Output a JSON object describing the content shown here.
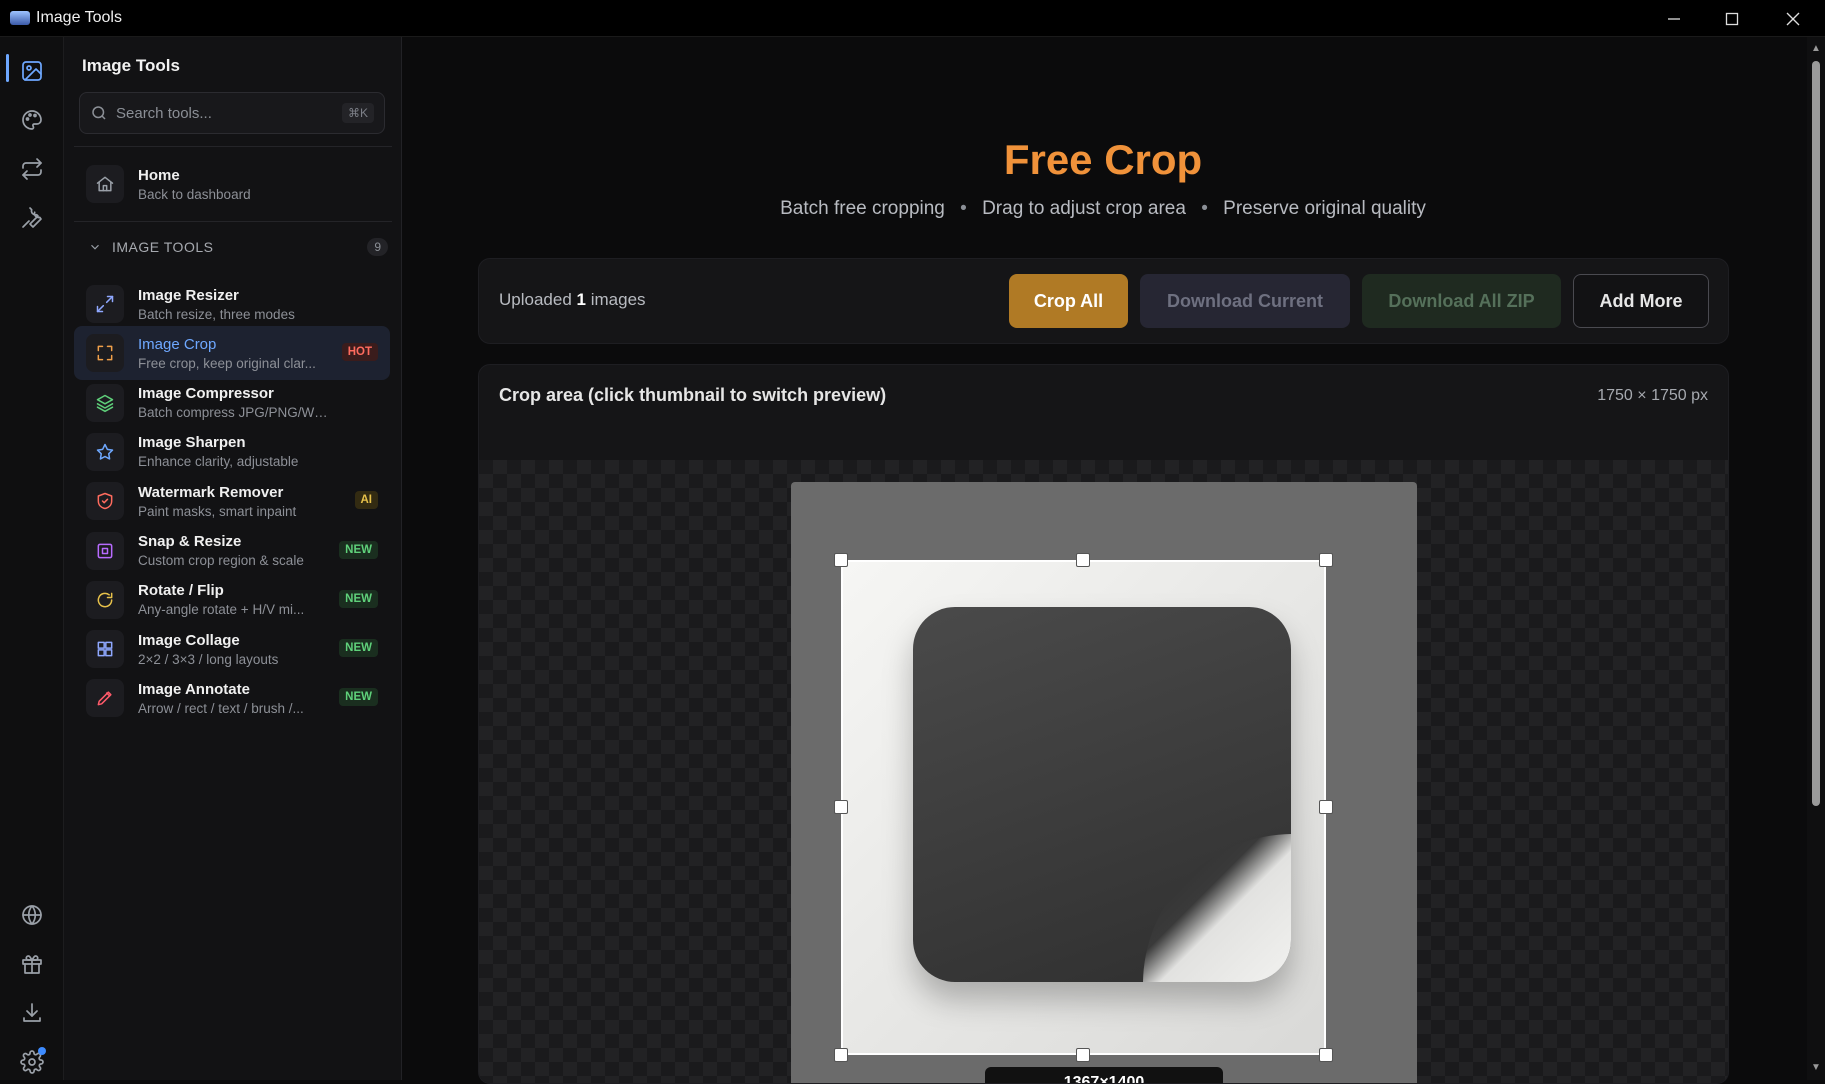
{
  "window": {
    "title": "Image Tools"
  },
  "sidebar": {
    "title": "Image Tools",
    "search": {
      "placeholder": "Search tools...",
      "shortcut": "⌘K"
    },
    "home": {
      "label": "Home",
      "desc": "Back to dashboard"
    },
    "section": {
      "label": "IMAGE TOOLS",
      "count": "9"
    },
    "items": [
      {
        "label": "Image Resizer",
        "desc": "Batch resize, three modes",
        "badge": "",
        "icon": "resize-icon",
        "color": "#8fa8ff"
      },
      {
        "label": "Image Crop",
        "desc": "Free crop, keep original clar...",
        "badge": "HOT",
        "icon": "crop-icon",
        "color": "#f0a04a",
        "active": true
      },
      {
        "label": "Image Compressor",
        "desc": "Batch compress JPG/PNG/WebP",
        "badge": "",
        "icon": "layers-icon",
        "color": "#5fd07a"
      },
      {
        "label": "Image Sharpen",
        "desc": "Enhance clarity, adjustable",
        "badge": "",
        "icon": "star-icon",
        "color": "#6ea8ff"
      },
      {
        "label": "Watermark Remover",
        "desc": "Paint masks, smart inpaint",
        "badge": "AI",
        "icon": "shield-icon",
        "color": "#ff6b5e"
      },
      {
        "label": "Snap & Resize",
        "desc": "Custom crop region & scale",
        "badge": "NEW",
        "icon": "snap-icon",
        "color": "#b86bff"
      },
      {
        "label": "Rotate / Flip",
        "desc": "Any-angle rotate + H/V mi...",
        "badge": "NEW",
        "icon": "rotate-icon",
        "color": "#e7c14a"
      },
      {
        "label": "Image Collage",
        "desc": "2×2 / 3×3 / long layouts",
        "badge": "NEW",
        "icon": "grid-icon",
        "color": "#8fa8ff"
      },
      {
        "label": "Image Annotate",
        "desc": "Arrow / rect / text / brush /...",
        "badge": "NEW",
        "icon": "pen-icon",
        "color": "#ff5a6a"
      }
    ]
  },
  "main": {
    "title": "Free Crop",
    "subtitle": [
      "Batch free cropping",
      "Drag to adjust crop area",
      "Preserve original quality"
    ],
    "subtitle_sep": "•",
    "uploaded_prefix": "Uploaded",
    "uploaded_count": "1",
    "uploaded_suffix": "images",
    "buttons": {
      "crop_all": "Crop All",
      "download_current": "Download Current",
      "download_zip": "Download All ZIP",
      "add_more": "Add More"
    },
    "crop_panel": {
      "header": "Crop area (click thumbnail to switch preview)",
      "image_dims": "1750 × 1750 px",
      "crop_dims": "1367×1400"
    }
  },
  "colors": {
    "accent": "#f0923a",
    "primary": "#6ea8ff",
    "crop_button": "#b07a25"
  }
}
